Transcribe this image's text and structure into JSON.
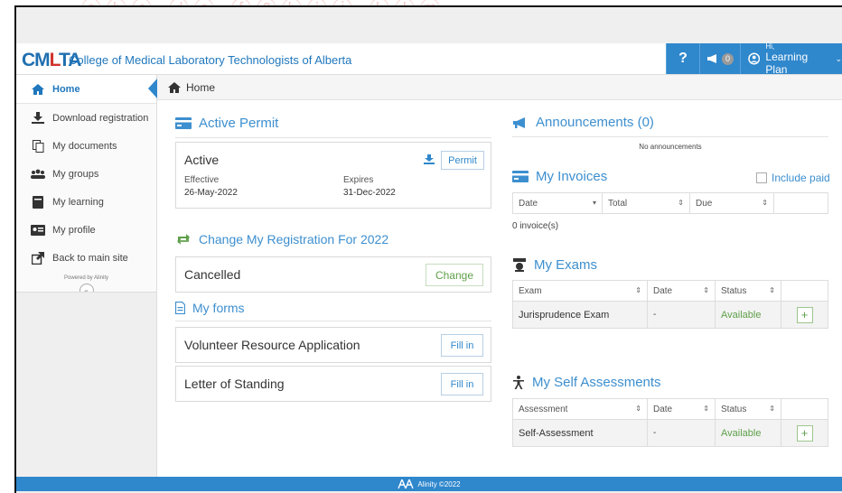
{
  "header": {
    "logo_main": "CM",
    "logo_red": "L",
    "logo_end": "TA",
    "org_name": "College of Medical Laboratory Technologists of Alberta",
    "help_label": "?",
    "announcement_count": "0",
    "user_greeting": "Hi,",
    "user_name": "Learning Plan"
  },
  "sidebar": {
    "items": [
      {
        "label": "Home",
        "icon": "home-icon"
      },
      {
        "label": "Download registration",
        "icon": "download-icon"
      },
      {
        "label": "My documents",
        "icon": "documents-icon"
      },
      {
        "label": "My groups",
        "icon": "groups-icon"
      },
      {
        "label": "My learning",
        "icon": "book-icon"
      },
      {
        "label": "My profile",
        "icon": "id-card-icon"
      },
      {
        "label": "Back to main site",
        "icon": "external-link-icon"
      }
    ],
    "powered_by": "Powered by Alinity",
    "collapse_label": "«"
  },
  "breadcrumb": {
    "label": "Home"
  },
  "permit": {
    "title": "Active Permit",
    "status": "Active",
    "permit_button": "Permit",
    "effective_label": "Effective",
    "effective_value": "26-May-2022",
    "expires_label": "Expires",
    "expires_value": "31-Dec-2022"
  },
  "registration": {
    "title": "Change My Registration For 2022",
    "status": "Cancelled",
    "change_button": "Change"
  },
  "forms": {
    "title": "My forms",
    "items": [
      {
        "label": "Volunteer Resource Application",
        "button": "Fill in"
      },
      {
        "label": "Letter of Standing",
        "button": "Fill in"
      }
    ]
  },
  "announcements": {
    "title": "Announcements (0)",
    "empty": "No announcements"
  },
  "invoices": {
    "title": "My Invoices",
    "include_paid": "Include paid",
    "columns": [
      "Date",
      "Total",
      "Due"
    ],
    "count_text": "0 invoice(s)"
  },
  "exams": {
    "title": "My Exams",
    "columns": [
      "Exam",
      "Date",
      "Status"
    ],
    "rows": [
      {
        "exam": "Jurisprudence Exam",
        "date": "-",
        "status": "Available"
      }
    ]
  },
  "self_assessments": {
    "title": "My Self Assessments",
    "columns": [
      "Assessment",
      "Date",
      "Status"
    ],
    "rows": [
      {
        "assessment": "Self-Assessment",
        "date": "-",
        "status": "Available"
      }
    ]
  },
  "footer": {
    "text": "Alinity ©2022"
  },
  "colors": {
    "accent": "#2f87cc",
    "available": "#5fa04a",
    "logo_red": "#d0342c"
  }
}
